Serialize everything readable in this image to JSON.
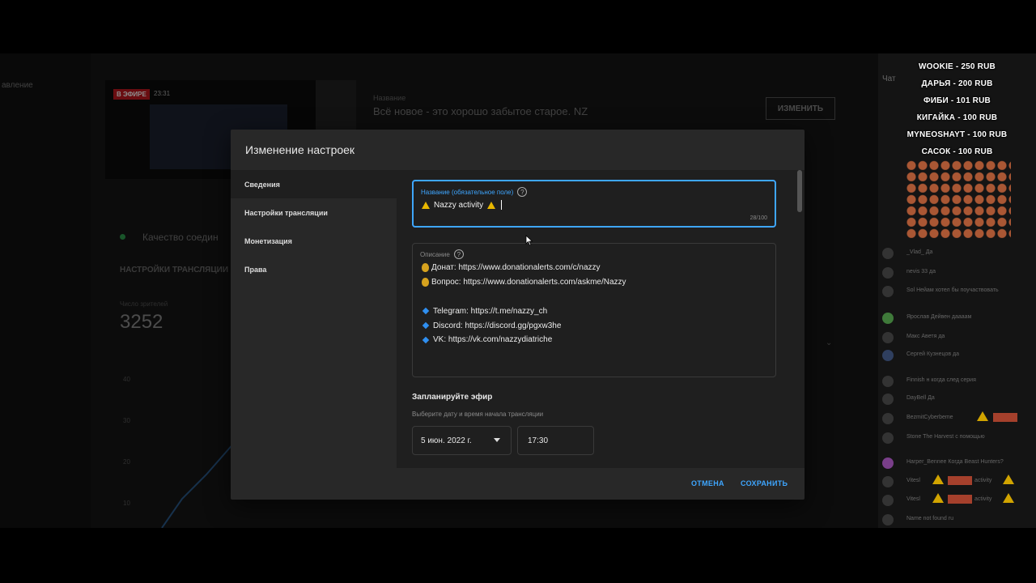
{
  "background": {
    "nav_text": "авление",
    "live_badge": "В ЭФИРЕ",
    "live_time": "23:31",
    "stream_title_label": "Название",
    "stream_title": "Всё новое - это хорошо забытое старое. NZ",
    "edit_button": "ИЗМЕНИТЬ",
    "quality_text": "Качество соедин",
    "section_title": "НАСТРОЙКИ ТРАНСЛЯЦИИ",
    "viewers_label": "Число зрителей",
    "viewers_count": "3252",
    "axis_ticks": [
      "40",
      "30",
      "20",
      "10"
    ]
  },
  "chat": {
    "header": "Чат",
    "donations": [
      "WOOKIE - 250 RUB",
      "ДАРЬЯ - 200 RUB",
      "ФИБИ - 101 RUB",
      "КИГАЙКА - 100 RUB",
      "MYNEOSHAYT - 100 RUB",
      "САСОК - 100 RUB"
    ],
    "messages": [
      {
        "author": "_Vlad_",
        "text": "Да"
      },
      {
        "author": "nevis 33",
        "text": "да"
      },
      {
        "author": "Sol",
        "text": "Нейам хотел бы поучаствовать"
      },
      {
        "author": "Ярослав Дейвен",
        "text": "даааам"
      },
      {
        "author": "Макс Аветя",
        "text": "да"
      },
      {
        "author": "Сергей Кузнецов",
        "text": "да"
      },
      {
        "author": "Finnish н",
        "text": "когда след серия"
      },
      {
        "author": "DayBell",
        "text": "Да"
      },
      {
        "author": "BezmitCyberbeme",
        "text": ""
      },
      {
        "author": "Stone",
        "text": "The Harvest с помощью"
      },
      {
        "author": "Harper_Bennee",
        "text": "Когда Beast Hunters?"
      },
      {
        "author": "Vitesl",
        "text": "activity"
      },
      {
        "author": "Vitesl",
        "text": "activity"
      },
      {
        "author": "Name not found",
        "text": "ru"
      }
    ]
  },
  "dialog": {
    "title": "Изменение настроек",
    "sidebar": [
      {
        "label": "Сведения",
        "active": true
      },
      {
        "label": "Настройки трансляции",
        "active": false
      },
      {
        "label": "Монетизация",
        "active": false
      },
      {
        "label": "Права",
        "active": false
      }
    ],
    "title_field": {
      "label": "Название (обязательное поле)",
      "value": "Nazzy activity",
      "counter": "28/100"
    },
    "description_field": {
      "label": "Описание",
      "lines": [
        {
          "icon": "money-bag-icon",
          "text": "Донат: https://www.donationalerts.com/c/nazzy"
        },
        {
          "icon": "money-bag-icon",
          "text": "Вопрос: https://www.donationalerts.com/askme/Nazzy"
        },
        {
          "icon": "",
          "text": ""
        },
        {
          "icon": "diamond-icon",
          "text": "Telegram: https://t.me/nazzy_ch"
        },
        {
          "icon": "diamond-icon",
          "text": "Discord: https://discord.gg/pgxw3he"
        },
        {
          "icon": "diamond-icon",
          "text": "VK: https://vk.com/nazzydiatriche"
        }
      ]
    },
    "schedule": {
      "title": "Запланируйте эфир",
      "hint": "Выберите дату и время начала трансляции",
      "date": "5 июн. 2022 г.",
      "time": "17:30"
    },
    "cancel": "ОТМЕНА",
    "save": "СОХРАНИТЬ"
  },
  "colors": {
    "accent": "#3ea6ff",
    "live_badge": "#c0181f",
    "warning": "#e8b700"
  }
}
